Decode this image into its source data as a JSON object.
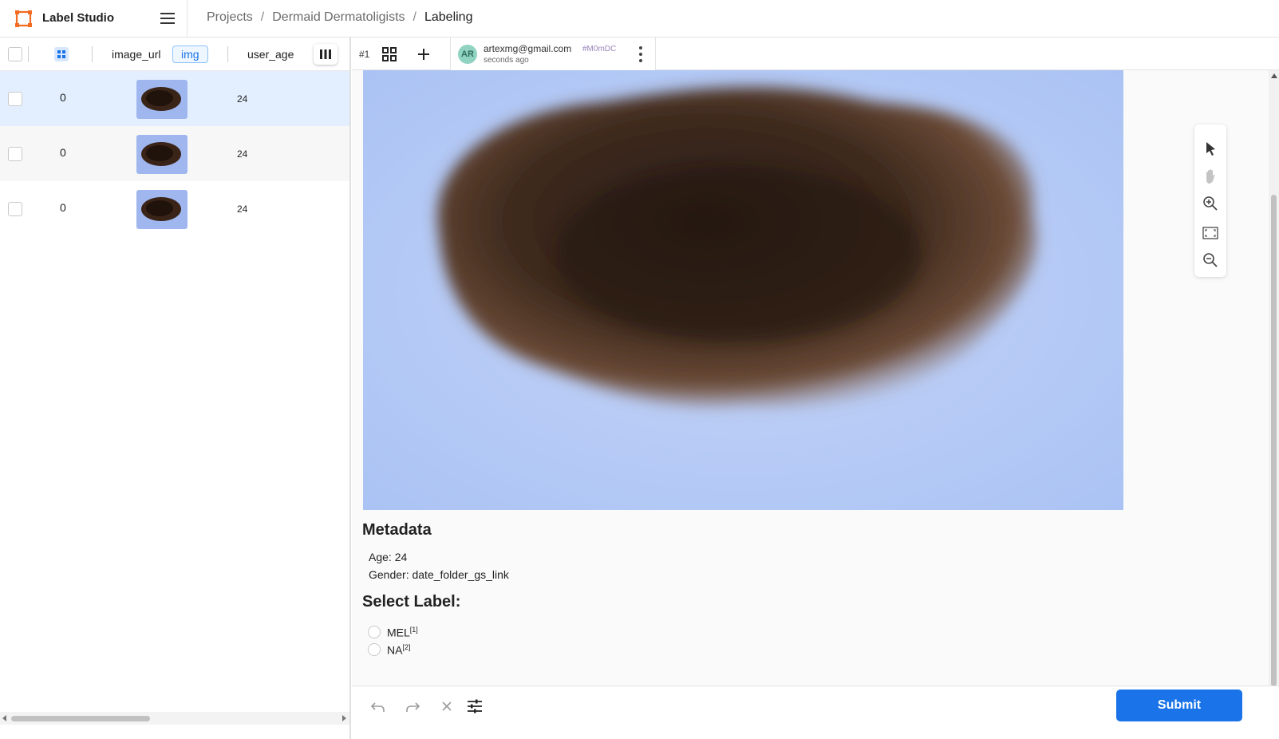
{
  "app": {
    "name": "Label Studio"
  },
  "breadcrumb": {
    "projects": "Projects",
    "sep1": "/",
    "project": "Dermaid Dermatoligists",
    "sep2": "/",
    "current": "Labeling"
  },
  "table": {
    "columns": {
      "image_url": "image_url",
      "image_tag": "img",
      "user_age": "user_age"
    },
    "rows": [
      {
        "id": "0",
        "age": "24"
      },
      {
        "id": "0",
        "age": "24"
      },
      {
        "id": "0",
        "age": "24"
      }
    ]
  },
  "annotation": {
    "tab_number": "#1",
    "avatar_initials": "AR",
    "email": "artexmg@gmail.com",
    "id": "#M0mDC",
    "time": "seconds ago"
  },
  "metadata": {
    "heading": "Metadata",
    "age_line": "Age: 24",
    "gender_line": "Gender: date_folder_gs_link"
  },
  "select_label": {
    "heading": "Select Label:",
    "options": [
      {
        "label": "MEL",
        "hotkey": "[1]"
      },
      {
        "label": "NA",
        "hotkey": "[2]"
      }
    ]
  },
  "actions": {
    "submit": "Submit"
  },
  "colors": {
    "accent": "#1a73e8",
    "selected_row": "#e3efff",
    "logo": "#f26b21"
  }
}
